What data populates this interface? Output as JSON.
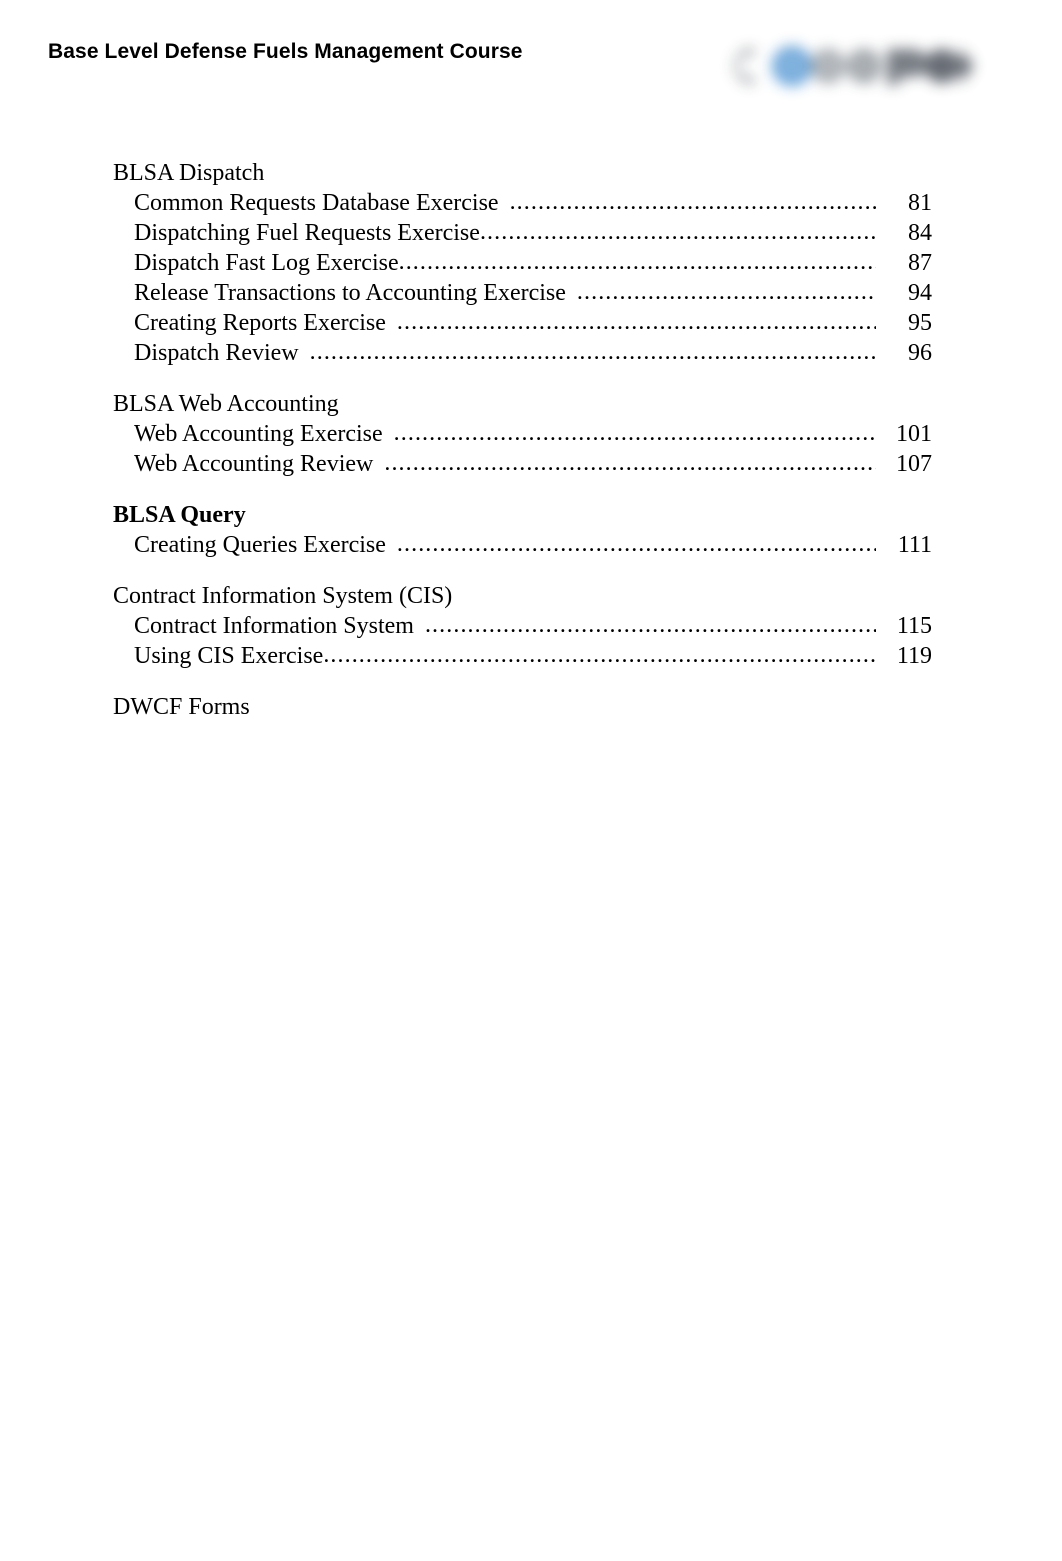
{
  "header": {
    "title": "Base Level Defense Fuels Management Course",
    "logo_alt": "company-logo",
    "logo_colors": {
      "gray": "#8c9197",
      "dark_gray": "#5a6069",
      "blue": "#5b9bd5"
    }
  },
  "toc": {
    "groups": [
      {
        "heading": "BLSA Dispatch",
        "heading_bold": false,
        "entries": [
          {
            "title": "Common Requests Database Exercise",
            "gap": true,
            "page": "81"
          },
          {
            "title": "Dispatching Fuel Requests Exercise",
            "gap": false,
            "page": "84"
          },
          {
            "title": "Dispatch Fast Log Exercise",
            "gap": false,
            "page": "87"
          },
          {
            "title": "Release Transactions to Accounting Exercise",
            "gap": true,
            "page": "94"
          },
          {
            "title": "Creating Reports Exercise",
            "gap": true,
            "page": "95"
          },
          {
            "title": "Dispatch Review",
            "gap": true,
            "page": "96"
          }
        ]
      },
      {
        "heading": "BLSA Web Accounting",
        "heading_bold": false,
        "entries": [
          {
            "title": "Web Accounting Exercise",
            "gap": true,
            "page": "101"
          },
          {
            "title": "Web Accounting Review",
            "gap": true,
            "page": "107"
          }
        ]
      },
      {
        "heading": "BLSA Query",
        "heading_bold": true,
        "entries": [
          {
            "title": "Creating Queries Exercise",
            "gap": true,
            "page": "111"
          }
        ]
      },
      {
        "heading": "Contract Information System (CIS)",
        "heading_bold": false,
        "entries": [
          {
            "title": "Contract Information System",
            "gap": true,
            "page": "115"
          },
          {
            "title": "Using CIS Exercise",
            "gap": false,
            "page": "119"
          }
        ]
      },
      {
        "heading": "DWCF Forms",
        "heading_bold": false,
        "entries": []
      }
    ]
  }
}
